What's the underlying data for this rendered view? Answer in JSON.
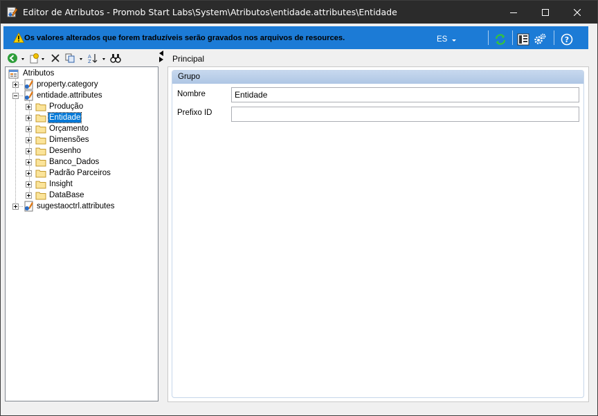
{
  "window": {
    "title": "Editor de Atributos - Promob Start Labs\\System\\Atributos\\entidade.attributes\\Entidade",
    "minimize_icon": "minimize-icon",
    "maximize_icon": "maximize-icon",
    "close_icon": "close-icon"
  },
  "infobar": {
    "message": "Os valores alterados que forem traduzíveis serão gravados nos arquivos de resources.",
    "language": "ES",
    "background_color": "#1c7bd6",
    "icons": [
      "warning-icon",
      "refresh-icon",
      "layout-icon",
      "settings-icon",
      "help-icon"
    ]
  },
  "toolbar": {
    "icons": [
      "back-icon",
      "new-attribute-icon",
      "delete-icon",
      "copy-icon",
      "sort-icon",
      "find-icon"
    ]
  },
  "tree": {
    "root": "Atributos",
    "items": [
      {
        "label": "property.category",
        "level": 1,
        "expander": "plus"
      },
      {
        "label": "entidade.attributes",
        "level": 1,
        "expander": "minus"
      },
      {
        "label": "Produção",
        "level": 2,
        "expander": "plus"
      },
      {
        "label": "Entidade",
        "level": 2,
        "expander": "plus",
        "selected": true
      },
      {
        "label": "Orçamento",
        "level": 2,
        "expander": "plus"
      },
      {
        "label": "Dimensões",
        "level": 2,
        "expander": "plus"
      },
      {
        "label": "Desenho",
        "level": 2,
        "expander": "plus"
      },
      {
        "label": "Banco_Dados",
        "level": 2,
        "expander": "plus"
      },
      {
        "label": "Padrão Parceiros",
        "level": 2,
        "expander": "plus"
      },
      {
        "label": "Insight",
        "level": 2,
        "expander": "plus"
      },
      {
        "label": "DataBase",
        "level": 2,
        "expander": "plus"
      },
      {
        "label": "sugestaoctrl.attributes",
        "level": 1,
        "expander": "plus"
      }
    ]
  },
  "right": {
    "tab": "Principal",
    "group_title": "Grupo",
    "fields": [
      {
        "label": "Nombre",
        "value": "Entidade"
      },
      {
        "label": "Prefixo ID",
        "value": ""
      }
    ]
  }
}
